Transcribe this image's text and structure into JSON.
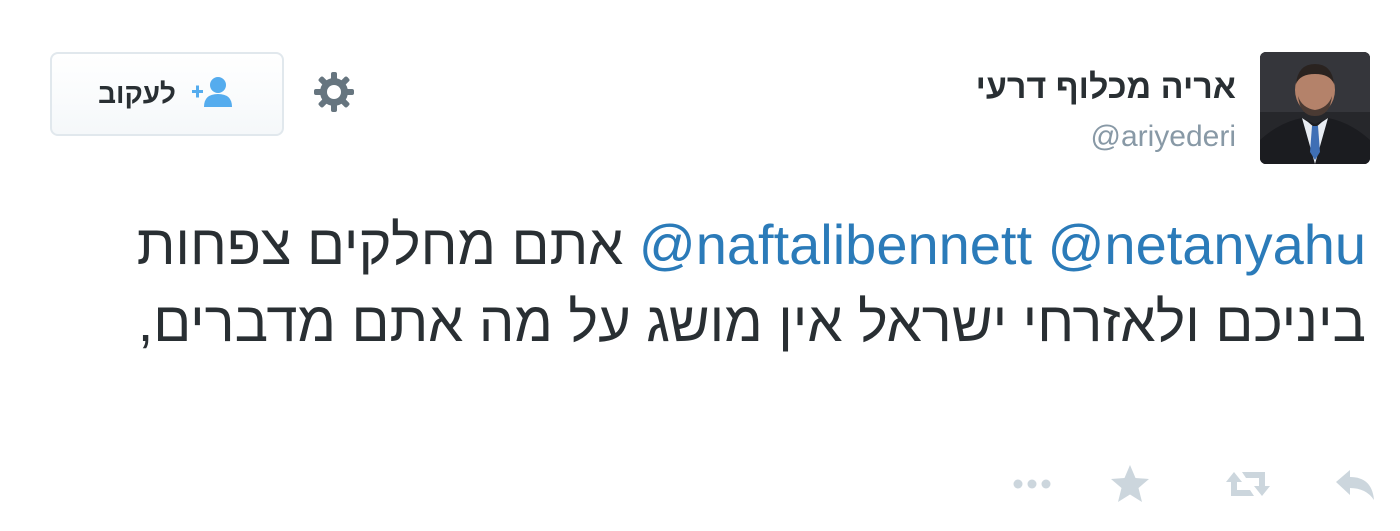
{
  "profile": {
    "name": "אריה מכלוף דרעי",
    "handle": "@ariyederi"
  },
  "follow_button": {
    "label": "לעקוב",
    "icon": "add-user-icon"
  },
  "settings": {
    "icon": "gear-icon"
  },
  "tweet": {
    "mention_1": "@netanyahu",
    "mention_2": "@naftalibennett",
    "text": "אתם מחלקים צפחות ביניכם ולאזרחי ישראל אין מושג על מה אתם מדברים,"
  },
  "actions": [
    "reply-icon",
    "retweet-icon",
    "favorite-icon",
    "more-icon"
  ],
  "colors": {
    "link": "#2b7bb9",
    "text": "#292f33",
    "muted": "#8899a6",
    "icon": "#ccd6dd"
  }
}
